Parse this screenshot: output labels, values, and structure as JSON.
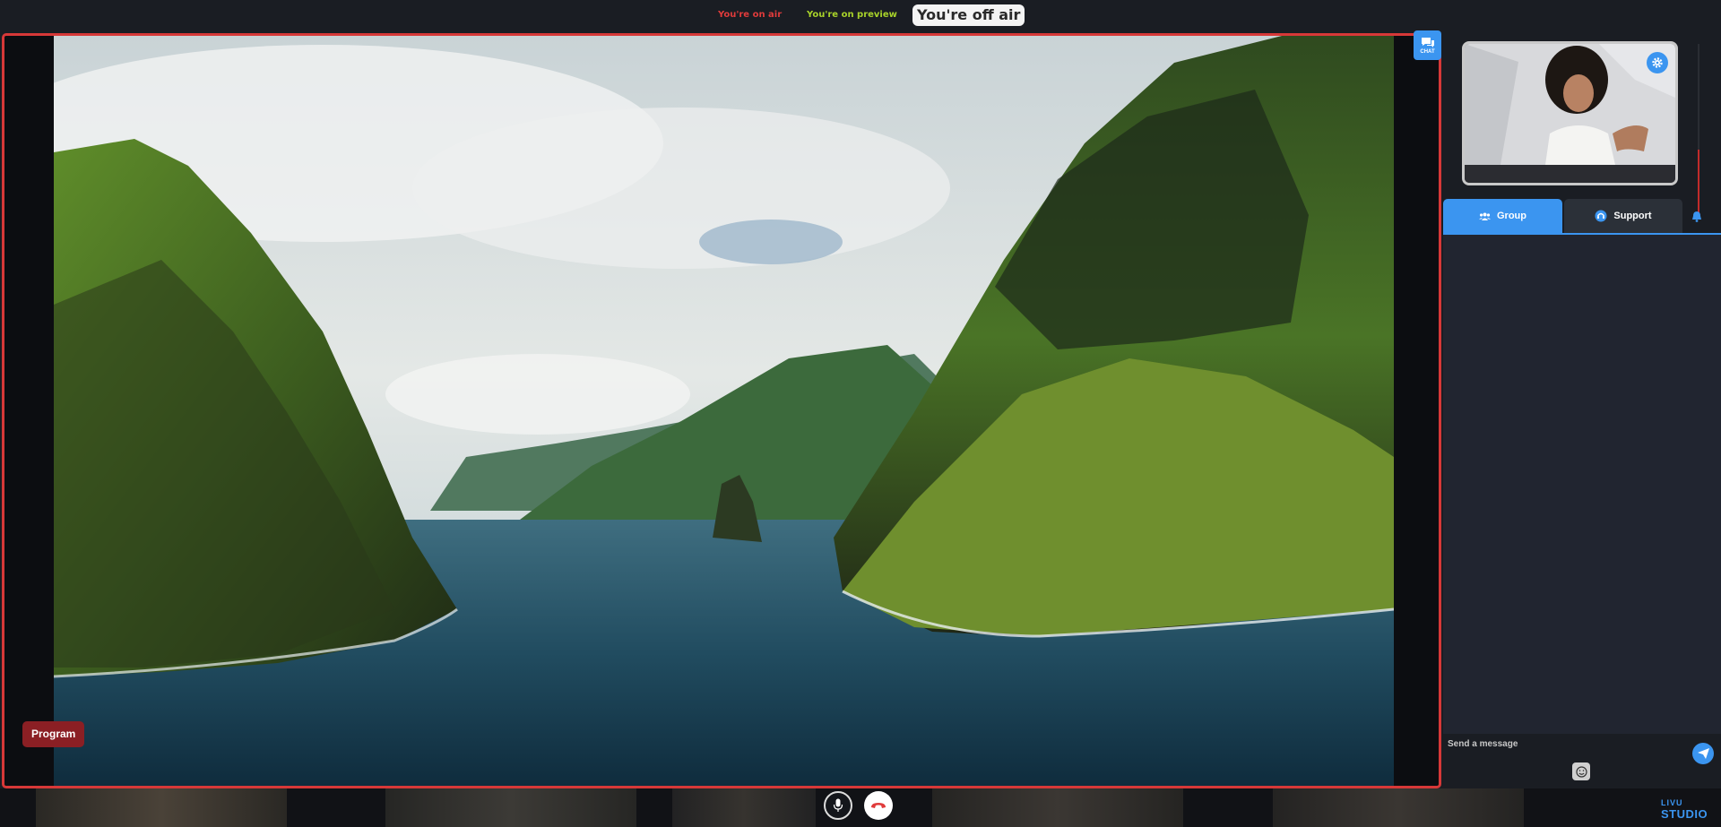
{
  "status_bar": {
    "on_air": "You're on air",
    "on_preview": "You're on preview",
    "off_air": "You're off air"
  },
  "stage": {
    "chat_button_label": "CHAT",
    "program_badge": "Program",
    "border_color": "#d73838"
  },
  "right_panel": {
    "tabs": [
      {
        "label": "Group",
        "icon": "group-icon",
        "active": true
      },
      {
        "label": "Support",
        "icon": "support-icon",
        "active": false
      }
    ],
    "composer_placeholder": "Send a message",
    "audio_level": 0.38
  },
  "controls": {
    "mic_icon": "microphone-icon",
    "hangup_icon": "phone-hangup-icon"
  },
  "brand": {
    "top": "LIVU",
    "main": "STUDIO"
  },
  "colors": {
    "accent": "#3b95f0",
    "live": "#e03b3b",
    "preview": "#a8d22a",
    "program_badge": "#8b1f24"
  }
}
